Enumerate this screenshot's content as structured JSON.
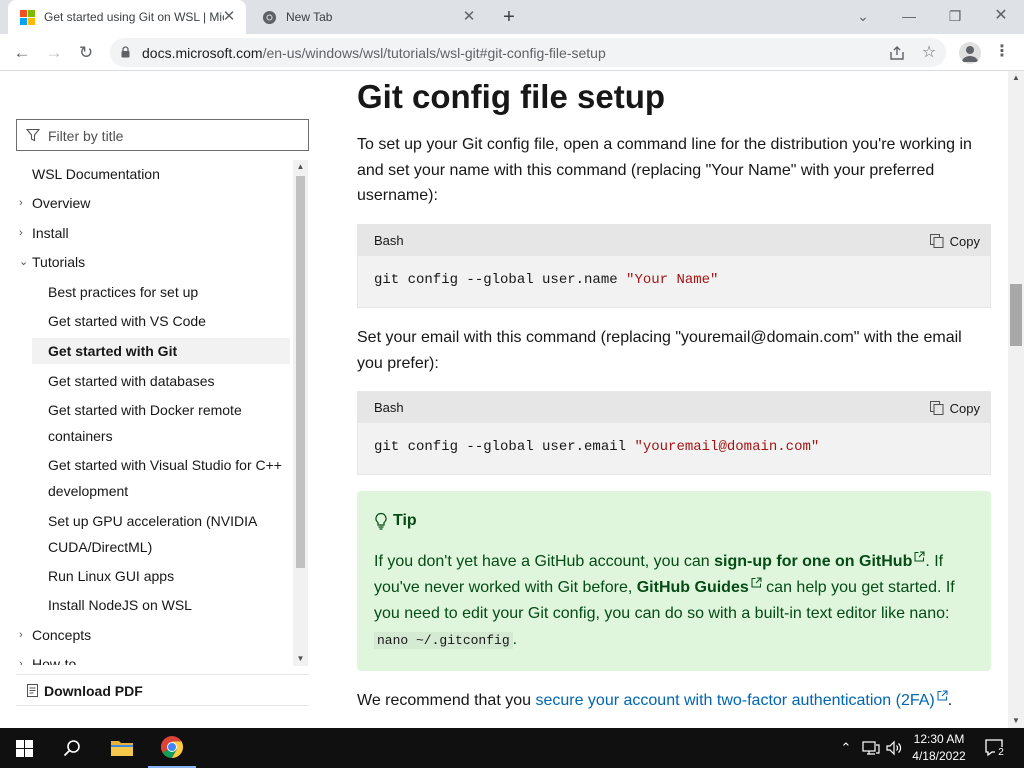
{
  "browser": {
    "tabs": [
      {
        "title": "Get started using Git on WSL | Microsoft Docs",
        "active": true
      },
      {
        "title": "New Tab",
        "active": false
      }
    ],
    "new_tab_symbol": "+",
    "url_host": "docs.microsoft.com",
    "url_path": "/en-us/windows/wsl/tutorials/wsl-git#git-config-file-setup"
  },
  "sidebar": {
    "filter_placeholder": "Filter by title",
    "toc": {
      "root": "WSL Documentation",
      "overview": "Overview",
      "install": "Install",
      "tutorials": "Tutorials",
      "best_practices": "Best practices for set up",
      "vscode": "Get started with VS Code",
      "git": "Get started with Git",
      "databases": "Get started with databases",
      "docker": "Get started with Docker remote containers",
      "visual_studio": "Get started with Visual Studio for C++ development",
      "gpu": "Set up GPU acceleration (NVIDIA CUDA/DirectML)",
      "gui_apps": "Run Linux GUI apps",
      "nodejs": "Install NodeJS on WSL",
      "concepts": "Concepts",
      "howto": "How-to"
    },
    "download_pdf": "Download PDF"
  },
  "article": {
    "heading": "Git config file setup",
    "intro": "To set up your Git config file, open a command line for the distribution you're working in and set your name with this command (replacing \"Your Name\" with your preferred username):",
    "code1": {
      "lang": "Bash",
      "copy": "Copy",
      "cmd": "git config --global user.name ",
      "str": "\"Your Name\""
    },
    "email_para": "Set your email with this command (replacing \"youremail@domain.com\" with the email you prefer):",
    "code2": {
      "lang": "Bash",
      "copy": "Copy",
      "cmd": "git config --global user.email ",
      "str": "\"youremail@domain.com\""
    },
    "tip": {
      "title": "Tip",
      "t1": "If you don't yet have a GitHub account, you can ",
      "link1": "sign-up for one on GitHub",
      "t2": ". If you've never worked with Git before, ",
      "link2": "GitHub Guides",
      "t3": " can help you get started. If you need to edit your Git config, you can do so with a built-in text editor like nano: ",
      "code": "nano ~/.gitconfig",
      "t4": "."
    },
    "recommend_text": "We recommend that you ",
    "recommend_link": "secure your account with two-factor authentication (2FA)",
    "recommend_end": "."
  },
  "taskbar": {
    "time": "12:30 AM",
    "date": "4/18/2022",
    "notification_count": "2"
  },
  "colors": {
    "link": "#0065b3",
    "tip_bg": "#dff6dd",
    "tip_text": "#054b16",
    "code_string": "#a31515"
  }
}
